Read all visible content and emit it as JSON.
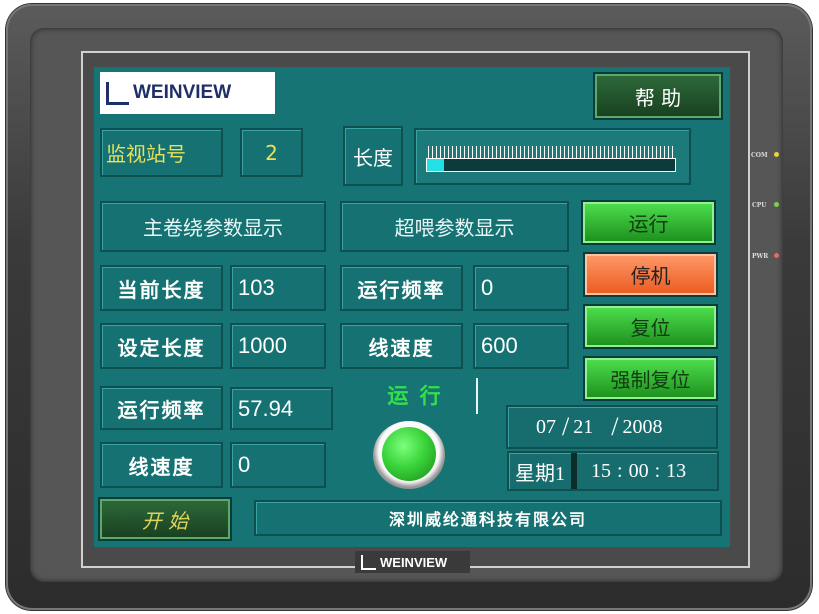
{
  "panel": {
    "brand_logo": "WEINVIEW",
    "bezel_logo": "WEINVIEW",
    "leds": [
      {
        "label": "COM",
        "color": "#e7d43a"
      },
      {
        "label": "CPU",
        "color": "#7cd24a"
      },
      {
        "label": "PWR",
        "color": "#e86a5a"
      }
    ]
  },
  "header": {
    "help_button": "帮 助",
    "station_label": "监视站号",
    "station_value": "2",
    "length_label": "长度",
    "length_progress": 0.07
  },
  "sections": {
    "main_winder": "主卷绕参数显示",
    "over_feed": "超喂参数显示"
  },
  "main_params": [
    {
      "label": "当前长度",
      "value": "103"
    },
    {
      "label": "设定长度",
      "value": "1000"
    },
    {
      "label": "运行频率",
      "value": "57.94"
    },
    {
      "label": "线速度",
      "value": "0"
    }
  ],
  "over_params": [
    {
      "label": "运行频率",
      "value": "0"
    },
    {
      "label": "线速度",
      "value": "600"
    }
  ],
  "controls": {
    "run": "运行",
    "stop": "停机",
    "reset": "复位",
    "force_reset": "强制复位",
    "start": "开 始"
  },
  "status": {
    "run_text": "运 行",
    "lamp_color": "#3ad43a"
  },
  "datetime": {
    "month": "07",
    "day": "21",
    "year": "2008",
    "sep": "/",
    "weekday": "星期1",
    "hour": "15",
    "minute": "00",
    "second": "13",
    "time_sep": ":"
  },
  "footer": {
    "company": "深圳威纶通科技有限公司"
  }
}
